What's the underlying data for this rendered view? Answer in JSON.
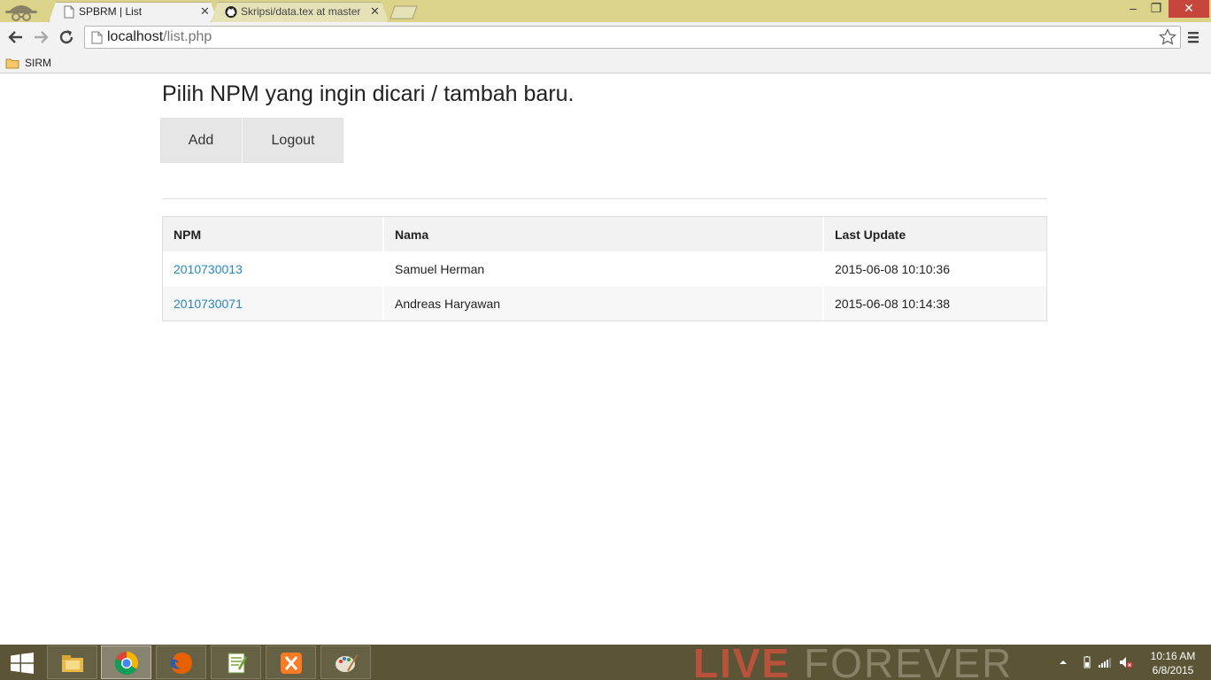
{
  "browser": {
    "tabs": [
      {
        "title": "SPBRM | List",
        "active": true
      },
      {
        "title": "Skripsi/data.tex at master",
        "active": false
      }
    ],
    "address": {
      "host": "localhost",
      "path": "/list.php"
    },
    "bookmarks": [
      {
        "label": "SIRM",
        "icon": "folder-icon"
      }
    ],
    "window_controls": {
      "minimize": "–",
      "restore": "❐",
      "close": "✕"
    }
  },
  "page": {
    "heading": "Pilih NPM yang ingin dicari / tambah baru.",
    "buttons": {
      "add": "Add",
      "logout": "Logout"
    },
    "table": {
      "headers": [
        "NPM",
        "Nama",
        "Last Update"
      ],
      "rows": [
        {
          "npm": "2010730013",
          "nama": "Samuel Herman",
          "last_update": "2015-06-08 10:10:36"
        },
        {
          "npm": "2010730071",
          "nama": "Andreas Haryawan",
          "last_update": "2015-06-08 10:14:38"
        }
      ]
    }
  },
  "taskbar": {
    "apps": [
      "file-explorer-icon",
      "chrome-icon",
      "firefox-icon",
      "notepadpp-icon",
      "xampp-icon",
      "paint-icon"
    ],
    "active_app": "chrome-icon",
    "wallpaper_text": {
      "bold": "LIVE",
      "light": "FOREVER"
    },
    "clock": {
      "time": "10:16 AM",
      "date": "6/8/2015"
    }
  },
  "colors": {
    "titlebar": "#dcd38a",
    "link": "#2a86c3",
    "button_bg": "#e6e6e6",
    "taskbar": "#5b5436"
  }
}
